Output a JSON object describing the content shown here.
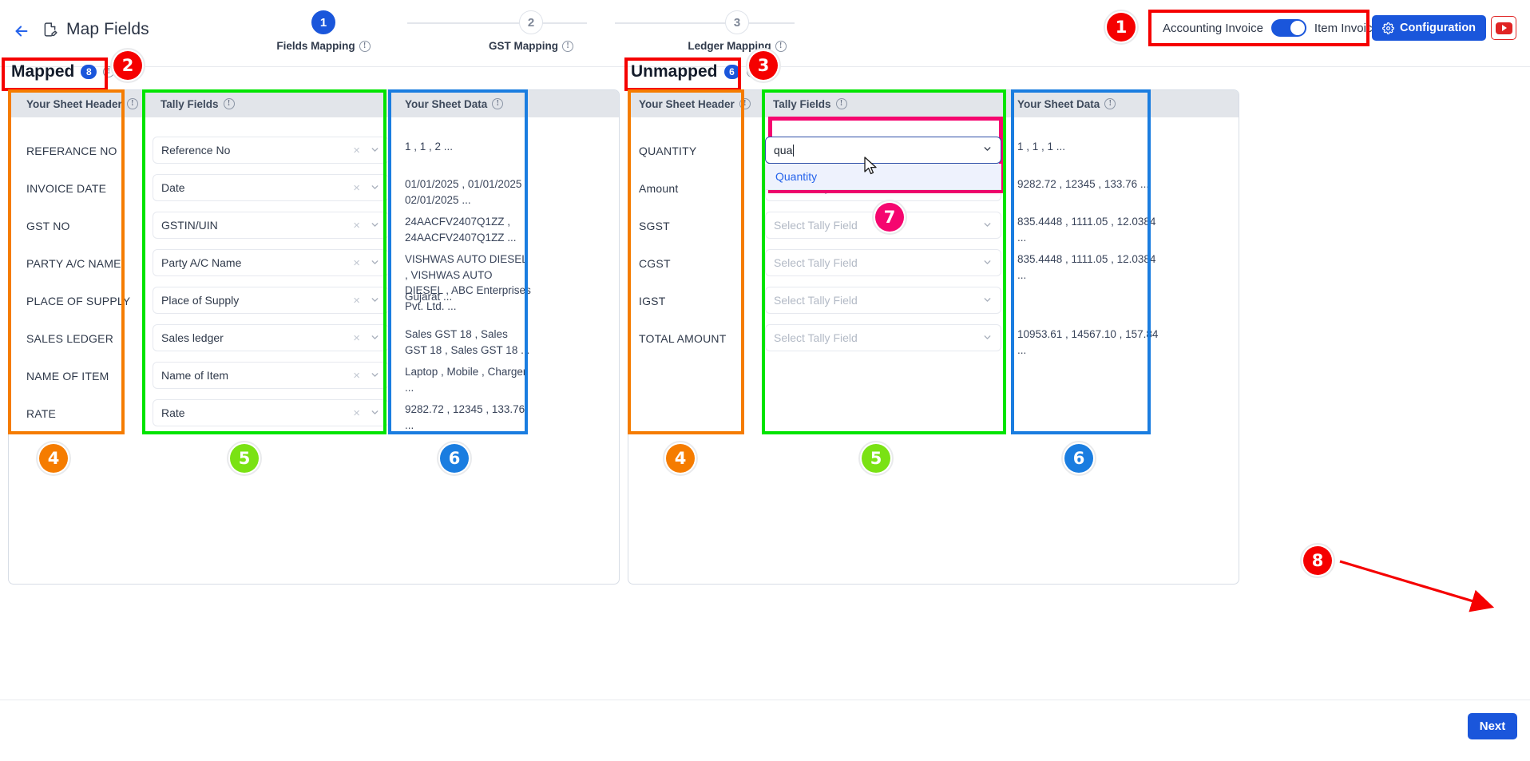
{
  "header": {
    "back_icon": "back-arrow-icon",
    "doc_icon": "document-edit-icon",
    "title": "Map Fields",
    "toggle_left_label": "Accounting Invoice",
    "toggle_right_label": "Item Invoice",
    "toggle_state": "Item Invoice",
    "configuration_label": "Configuration",
    "gear_icon": "gear-icon",
    "youtube_icon": "youtube-icon"
  },
  "stepper": {
    "steps": [
      {
        "number": "1",
        "label": "Fields Mapping",
        "active": true
      },
      {
        "number": "2",
        "label": "GST Mapping",
        "active": false
      },
      {
        "number": "3",
        "label": "Ledger Mapping",
        "active": false
      }
    ]
  },
  "mapped": {
    "title": "Mapped",
    "count": "8",
    "columns": [
      "Your Sheet Header",
      "Tally Fields",
      "Your Sheet Data"
    ],
    "rows": [
      {
        "sheet_header": "REFERANCE NO",
        "tally_field": "Reference No",
        "sheet_data": "1 , 1 , 2 ..."
      },
      {
        "sheet_header": "INVOICE DATE",
        "tally_field": "Date",
        "sheet_data": "01/01/2025 , 01/01/2025 , 02/01/2025 ..."
      },
      {
        "sheet_header": "GST NO",
        "tally_field": "GSTIN/UIN",
        "sheet_data": "24AACFV2407Q1ZZ , 24AACFV2407Q1ZZ ..."
      },
      {
        "sheet_header": "PARTY A/C NAME",
        "tally_field": "Party A/C Name",
        "sheet_data": "VISHWAS AUTO DIESEL , VISHWAS AUTO DIESEL , ABC Enterprises Pvt. Ltd. ..."
      },
      {
        "sheet_header": "PLACE OF SUPPLY",
        "tally_field": "Place of Supply",
        "sheet_data": "Gujarat ..."
      },
      {
        "sheet_header": "SALES LEDGER",
        "tally_field": "Sales ledger",
        "sheet_data": "Sales GST 18 , Sales GST 18 , Sales GST 18 ..."
      },
      {
        "sheet_header": "NAME OF ITEM",
        "tally_field": "Name of Item",
        "sheet_data": "Laptop , Mobile , Charger ..."
      },
      {
        "sheet_header": "RATE",
        "tally_field": "Rate",
        "sheet_data": "9282.72 , 12345 , 133.76 ..."
      }
    ],
    "clear_icon": "clear-x-icon",
    "chevron_icon": "chevron-down-icon"
  },
  "unmapped": {
    "title": "Unmapped",
    "count": "6",
    "columns": [
      "Your Sheet Header",
      "Tally Fields",
      "Your Sheet Data"
    ],
    "placeholder": "Select Tally Field",
    "rows": [
      {
        "sheet_header": "QUANTITY",
        "tally_field": "",
        "sheet_data": "1 , 1 , 1 ..."
      },
      {
        "sheet_header": "Amount",
        "tally_field": "",
        "sheet_data": "9282.72 , 12345 , 133.76 ..."
      },
      {
        "sheet_header": "SGST",
        "tally_field": "",
        "sheet_data": "835.4448 , 1111.05 , 12.0384 ..."
      },
      {
        "sheet_header": "CGST",
        "tally_field": "",
        "sheet_data": "835.4448 , 1111.05 , 12.0384 ..."
      },
      {
        "sheet_header": "IGST",
        "tally_field": "",
        "sheet_data": ""
      },
      {
        "sheet_header": "TOTAL AMOUNT",
        "tally_field": "",
        "sheet_data": "10953.61 , 14567.10 , 157.84 ..."
      }
    ],
    "open_combo": {
      "typed_value": "qua",
      "options": [
        "Quantity"
      ]
    }
  },
  "footer": {
    "next_label": "Next"
  },
  "annotations": {
    "colors": {
      "red": "#f50000",
      "orange": "#f57c00",
      "green": "#00e400",
      "blue": "#1a7de0",
      "pink": "#f5066f"
    },
    "badges": [
      {
        "id": "1",
        "color": "#f50000"
      },
      {
        "id": "2",
        "color": "#f50000"
      },
      {
        "id": "3",
        "color": "#f50000"
      },
      {
        "id": "4",
        "color": "#f57c00"
      },
      {
        "id": "5",
        "color": "#7ae213"
      },
      {
        "id": "6",
        "color": "#1a7de0"
      },
      {
        "id": "4b",
        "label": "4",
        "color": "#f57c00"
      },
      {
        "id": "5b",
        "label": "5",
        "color": "#7ae213"
      },
      {
        "id": "6b",
        "label": "6",
        "color": "#1a7de0"
      },
      {
        "id": "7",
        "color": "#f5066f"
      },
      {
        "id": "8",
        "color": "#f50000"
      }
    ]
  }
}
